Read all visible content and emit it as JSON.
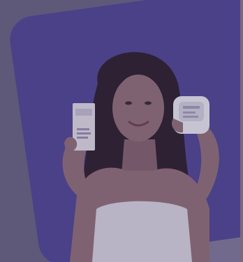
{
  "hero": {
    "colors": {
      "background": "#655f7f",
      "card": "#4f4690",
      "hair": "#2e2232",
      "skin": "#8a6a78",
      "top": "#c9c6d4",
      "product_box": "#cfcbd9",
      "device": "#d9d7e2"
    },
    "icons": {
      "product_box": "product-box-icon",
      "device": "device-icon"
    }
  }
}
